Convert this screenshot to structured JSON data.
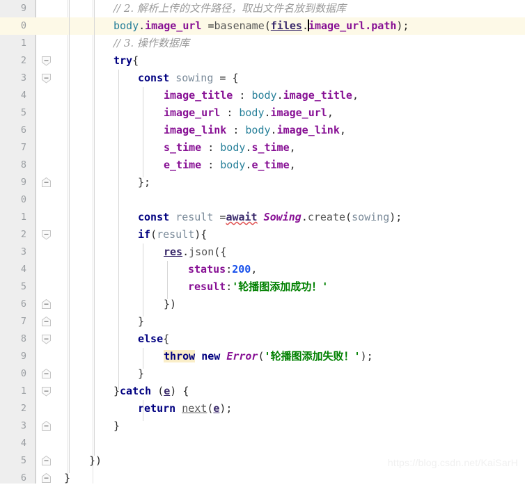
{
  "editor": {
    "watermark": "https://blog.csdn.net/KaiSarH",
    "colors": {
      "background": "#ffffff",
      "gutter": "#eeeeee",
      "current_line": "#fdf9e7",
      "line_number": "#999da1",
      "keyword": "#000080",
      "property": "#871094",
      "object": "#267f99",
      "string": "#008000",
      "number": "#1750eb",
      "comment": "#9a9a9a",
      "identifier": "#7a8a99",
      "highlight_word": "#faeec8",
      "error_squiggle": "#e05252"
    },
    "line_height": 25,
    "current_line_index": 1
  },
  "lines": [
    {
      "num": "9",
      "indent": 0
    },
    {
      "num": "0",
      "indent": 0
    },
    {
      "num": "1",
      "indent": 0
    },
    {
      "num": "2",
      "indent": 0
    },
    {
      "num": "3",
      "indent": 0
    },
    {
      "num": "4",
      "indent": 0
    },
    {
      "num": "5",
      "indent": 0
    },
    {
      "num": "6",
      "indent": 0
    },
    {
      "num": "7",
      "indent": 0
    },
    {
      "num": "8",
      "indent": 0
    },
    {
      "num": "9",
      "indent": 0
    },
    {
      "num": "0",
      "indent": 0
    },
    {
      "num": "1",
      "indent": 0
    },
    {
      "num": "2",
      "indent": 0
    },
    {
      "num": "3",
      "indent": 0
    },
    {
      "num": "4",
      "indent": 0
    },
    {
      "num": "5",
      "indent": 0
    },
    {
      "num": "6",
      "indent": 0
    },
    {
      "num": "7",
      "indent": 0
    },
    {
      "num": "8",
      "indent": 0
    },
    {
      "num": "9",
      "indent": 0
    },
    {
      "num": "0",
      "indent": 0
    },
    {
      "num": "1",
      "indent": 0
    },
    {
      "num": "2",
      "indent": 0
    },
    {
      "num": "3",
      "indent": 0
    },
    {
      "num": "4",
      "indent": 0
    },
    {
      "num": "5",
      "indent": 0
    },
    {
      "num": "6",
      "indent": 0
    }
  ],
  "code_text": [
    "// 2. 解析上传的文件路径，取出文件名放到数据库",
    "body.image_url =basename(files.image_url.path);",
    "// 3. 操作数据库",
    "try{",
    "    const sowing = {",
    "        image_title : body.image_title,",
    "        image_url : body.image_url,",
    "        image_link : body.image_link,",
    "        s_time : body.s_time,",
    "        e_time : body.e_time,",
    "    };",
    "",
    "    const result =await Sowing.create(sowing);",
    "    if(result){",
    "        res.json({",
    "            status:200,",
    "            result:'轮播图添加成功！'",
    "        })",
    "    }",
    "    else{",
    "        throw new Error('轮播图添加失败！');",
    "    }",
    "}catch (e) {",
    "    return next(e);",
    "}",
    "",
    "})",
    "}"
  ],
  "fold_markers": [
    {
      "row": 3,
      "state": "expanded-open"
    },
    {
      "row": 4,
      "state": "expanded-open"
    },
    {
      "row": 12,
      "state": "expanded-mid"
    },
    {
      "row": 13,
      "state": "expanded-open"
    },
    {
      "row": 14,
      "state": "expanded-open"
    },
    {
      "row": 17,
      "state": "expanded-mid"
    },
    {
      "row": 18,
      "state": "expanded-mid"
    },
    {
      "row": 19,
      "state": "expanded-open"
    },
    {
      "row": 21,
      "state": "expanded-mid"
    },
    {
      "row": 22,
      "state": "expanded-open"
    },
    {
      "row": 24,
      "state": "expanded-mid"
    },
    {
      "row": 26,
      "state": "expanded-mid"
    },
    {
      "row": 27,
      "state": "expanded-mid"
    }
  ]
}
